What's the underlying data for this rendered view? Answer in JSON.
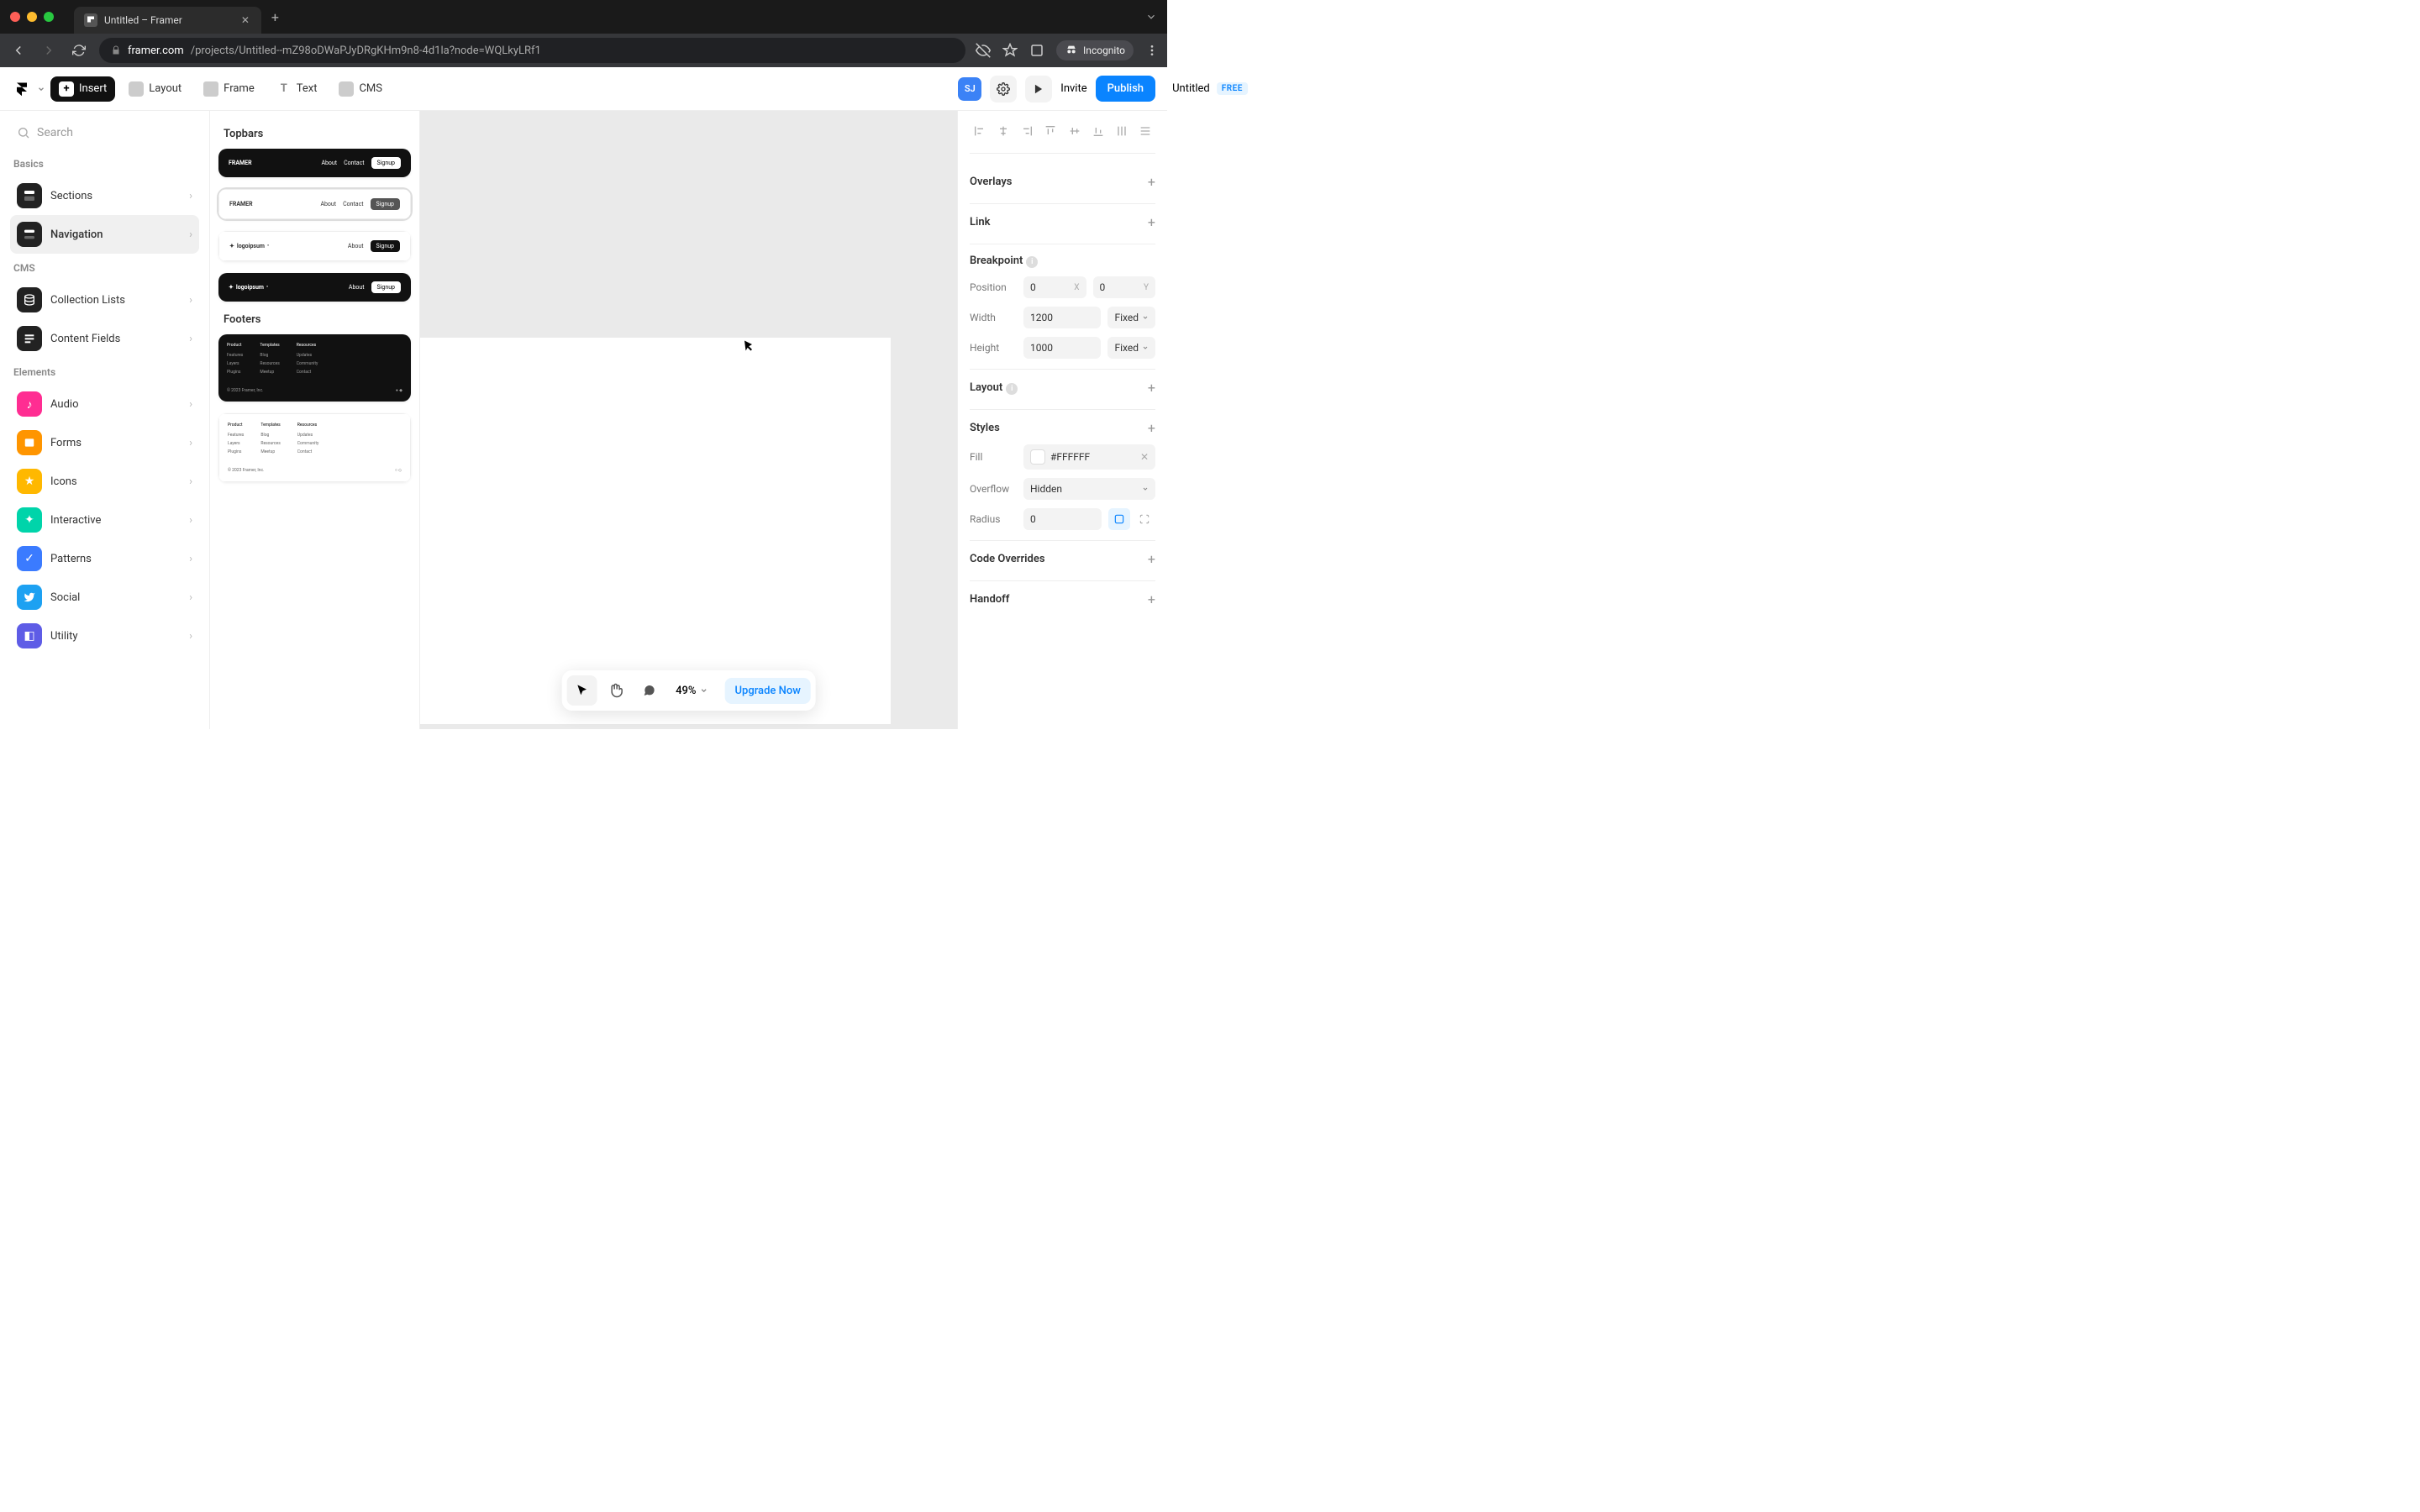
{
  "browser": {
    "tab_title": "Untitled – Framer",
    "url_domain": "framer.com",
    "url_path": "/projects/Untitled--mZ98oDWaPJyDRgKHm9n8-4d1la?node=WQLkyLRf1",
    "incognito_label": "Incognito"
  },
  "toolbar": {
    "insert": "Insert",
    "layout": "Layout",
    "frame": "Frame",
    "text": "Text",
    "cms": "CMS",
    "title": "Untitled",
    "badge": "FREE",
    "avatar": "SJ",
    "invite": "Invite",
    "publish": "Publish"
  },
  "sidebar": {
    "search_placeholder": "Search",
    "groups": [
      {
        "label": "Basics",
        "items": [
          {
            "label": "Sections",
            "icon": "sections",
            "color": "dark"
          },
          {
            "label": "Navigation",
            "icon": "navigation",
            "color": "dark",
            "active": true
          }
        ]
      },
      {
        "label": "CMS",
        "items": [
          {
            "label": "Collection Lists",
            "icon": "collection",
            "color": "dark"
          },
          {
            "label": "Content Fields",
            "icon": "fields",
            "color": "dark"
          }
        ]
      },
      {
        "label": "Elements",
        "items": [
          {
            "label": "Audio",
            "icon": "audio",
            "color": "pink"
          },
          {
            "label": "Forms",
            "icon": "forms",
            "color": "orange"
          },
          {
            "label": "Icons",
            "icon": "icons",
            "color": "yellow"
          },
          {
            "label": "Interactive",
            "icon": "interactive",
            "color": "teal"
          },
          {
            "label": "Patterns",
            "icon": "patterns",
            "color": "blueg"
          },
          {
            "label": "Social",
            "icon": "social",
            "color": "twitter"
          },
          {
            "label": "Utility",
            "icon": "utility",
            "color": "purple"
          }
        ]
      }
    ]
  },
  "insert_panel": {
    "section1": "Topbars",
    "section2": "Footers",
    "topbar": {
      "brand1": "FRAMER",
      "brand2": "logoipsum",
      "about": "About",
      "contact": "Contact",
      "signup": "Signup"
    },
    "footer": {
      "col1": {
        "h": "Product",
        "a": "Features",
        "b": "Layers",
        "c": "Plugins"
      },
      "col2": {
        "h": "Templates",
        "a": "Blog",
        "b": "Resources",
        "c": "Meetup"
      },
      "col3": {
        "h": "Resources",
        "a": "Updates",
        "b": "Community",
        "c": "Contact"
      },
      "copyright": "© 2023 Framer, Inc."
    }
  },
  "floatbar": {
    "zoom": "49%",
    "upgrade": "Upgrade Now"
  },
  "inspector": {
    "overlays": "Overlays",
    "link": "Link",
    "breakpoint": "Breakpoint",
    "position": "Position",
    "position_x": "0",
    "position_y": "0",
    "width_label": "Width",
    "width": "1200",
    "width_mode": "Fixed",
    "height_label": "Height",
    "height": "1000",
    "height_mode": "Fixed",
    "layout": "Layout",
    "styles": "Styles",
    "fill_label": "Fill",
    "fill": "#FFFFFF",
    "overflow_label": "Overflow",
    "overflow": "Hidden",
    "radius_label": "Radius",
    "radius": "0",
    "code_overrides": "Code Overrides",
    "handoff": "Handoff"
  }
}
